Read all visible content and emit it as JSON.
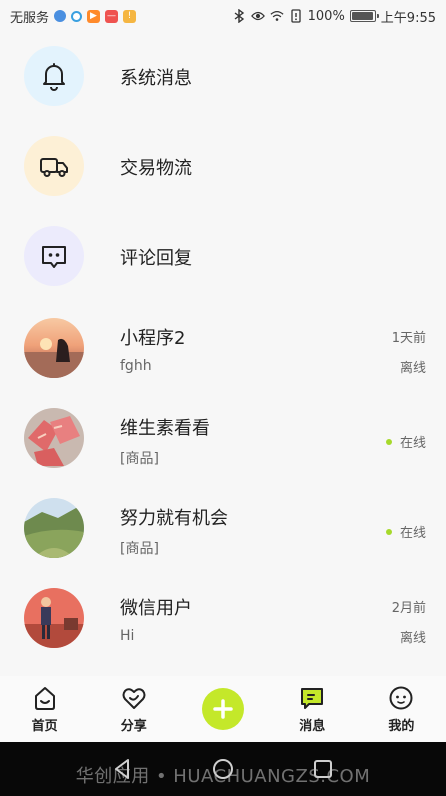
{
  "status_bar": {
    "carrier": "无服务",
    "battery": "100%",
    "battery_level": 1.0,
    "time": "上午9:55"
  },
  "system_rows": [
    {
      "label": "系统消息",
      "icon": "bell-icon",
      "bg": "#e3f3fd"
    },
    {
      "label": "交易物流",
      "icon": "truck-icon",
      "bg": "#fdf0d6"
    },
    {
      "label": "评论回复",
      "icon": "comment-icon",
      "bg": "#ecebfc"
    }
  ],
  "conversations": [
    {
      "name": "小程序2",
      "preview": "fghh",
      "time": "1天前",
      "status": "离线",
      "online": false
    },
    {
      "name": "维生素看看",
      "preview": "[商品]",
      "time": "",
      "status": "在线",
      "online": true
    },
    {
      "name": "努力就有机会",
      "preview": "[商品]",
      "time": "",
      "status": "在线",
      "online": true
    },
    {
      "name": "微信用户",
      "preview": "Hi",
      "time": "2月前",
      "status": "离线",
      "online": false
    }
  ],
  "tabbar": {
    "home": "首页",
    "share": "分享",
    "messages": "消息",
    "mine": "我的",
    "accent": "#c4e82a"
  },
  "watermark": "华创应用 • HUACHUANGZS.COM"
}
